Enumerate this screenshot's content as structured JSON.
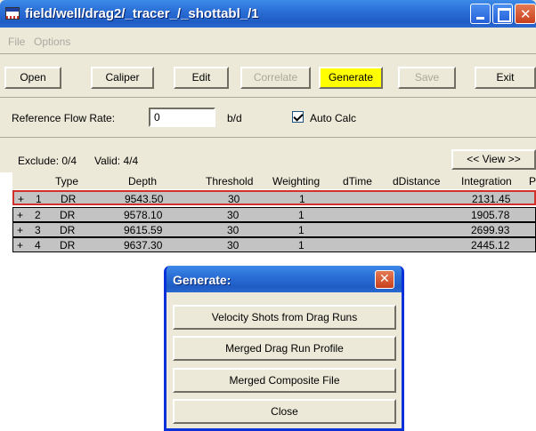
{
  "window": {
    "title": "field/well/drag2/_tracer_/_shottabl_/1"
  },
  "menu": {
    "file": "File",
    "options": "Options"
  },
  "toolbar": {
    "open": "Open",
    "caliper": "Caliper",
    "edit": "Edit",
    "correlate": "Correlate",
    "generate": "Generate",
    "save": "Save",
    "exit": "Exit"
  },
  "reference": {
    "label": "Reference Flow Rate:",
    "value": "0",
    "unit": "b/d",
    "auto_calc_label": "Auto Calc",
    "auto_calc_checked": true
  },
  "stats": {
    "exclude": "Exclude:  0/4",
    "valid": "Valid:  4/4",
    "view_button": "<< View >>"
  },
  "table": {
    "columns": [
      "Type",
      "Depth",
      "Threshold",
      "Weighting",
      "dTime",
      "dDistance",
      "Integration",
      "P"
    ],
    "rows": [
      {
        "marker": "+",
        "index": "1",
        "type": "DR",
        "depth": "9543.50",
        "threshold": "30",
        "weighting": "1",
        "dtime": "",
        "ddistance": "",
        "integration": "2131.45"
      },
      {
        "marker": "+",
        "index": "2",
        "type": "DR",
        "depth": "9578.10",
        "threshold": "30",
        "weighting": "1",
        "dtime": "",
        "ddistance": "",
        "integration": "1905.78"
      },
      {
        "marker": "+",
        "index": "3",
        "type": "DR",
        "depth": "9615.59",
        "threshold": "30",
        "weighting": "1",
        "dtime": "",
        "ddistance": "",
        "integration": "2699.93"
      },
      {
        "marker": "+",
        "index": "4",
        "type": "DR",
        "depth": "9637.30",
        "threshold": "30",
        "weighting": "1",
        "dtime": "",
        "ddistance": "",
        "integration": "2445.12"
      }
    ]
  },
  "dialog": {
    "title": "Generate:",
    "buttons": [
      "Velocity Shots from Drag Runs",
      "Merged Drag Run Profile",
      "Merged Composite File",
      "Close"
    ]
  },
  "colors": {
    "titlebar": "#2a6fd6",
    "window_bg": "#ece9d8",
    "generate_highlight": "#ffff00",
    "row_bg": "#c3c3c3",
    "selected_border": "#d2302a"
  }
}
